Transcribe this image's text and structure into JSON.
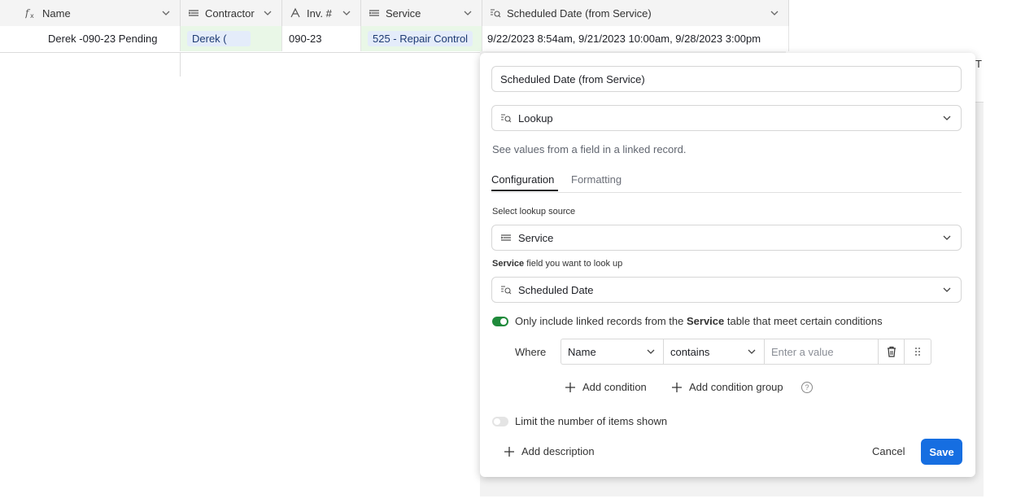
{
  "table": {
    "columns": [
      {
        "name": "Name",
        "icon": "formula-icon"
      },
      {
        "name": "Contractor",
        "icon": "link-icon"
      },
      {
        "name": "Inv. #",
        "icon": "text-icon"
      },
      {
        "name": "Service",
        "icon": "link-icon"
      },
      {
        "name": "Scheduled Date (from Service)",
        "icon": "lookup-icon"
      }
    ],
    "row": {
      "name": "Derek -090-23 Pending",
      "contractor": "Derek (",
      "inv": "090-23",
      "service": "525 - Repair Control",
      "scheduled": "9/22/2023 8:54am, 9/21/2023 10:00am, 9/28/2023 3:00pm"
    },
    "behind_text": "T"
  },
  "panel": {
    "field_name": "Scheduled Date (from Service)",
    "field_type": "Lookup",
    "helper": "See values from a field in a linked record.",
    "tabs": [
      "Configuration",
      "Formatting"
    ],
    "lookup_source_label": "Select lookup source",
    "lookup_source_value": "Service",
    "lookup_field_label_bold": "Service",
    "lookup_field_label_rest": " field you want to look up",
    "lookup_field_value": "Scheduled Date",
    "condition_toggle_text_pre": "Only include linked records from the ",
    "condition_toggle_text_bold": "Service",
    "condition_toggle_text_post": " table that meet certain conditions",
    "where_label": "Where",
    "condition": {
      "field": "Name",
      "operator": "contains",
      "value_placeholder": "Enter a value"
    },
    "add_condition": "Add condition",
    "add_condition_group": "Add condition group",
    "limit_text": "Limit the number of items shown",
    "add_description": "Add description",
    "cancel": "Cancel",
    "save": "Save"
  },
  "colors": {
    "accent": "#166ee1",
    "toggle_on": "#20c933",
    "green_cell": "#e9f7e7"
  }
}
